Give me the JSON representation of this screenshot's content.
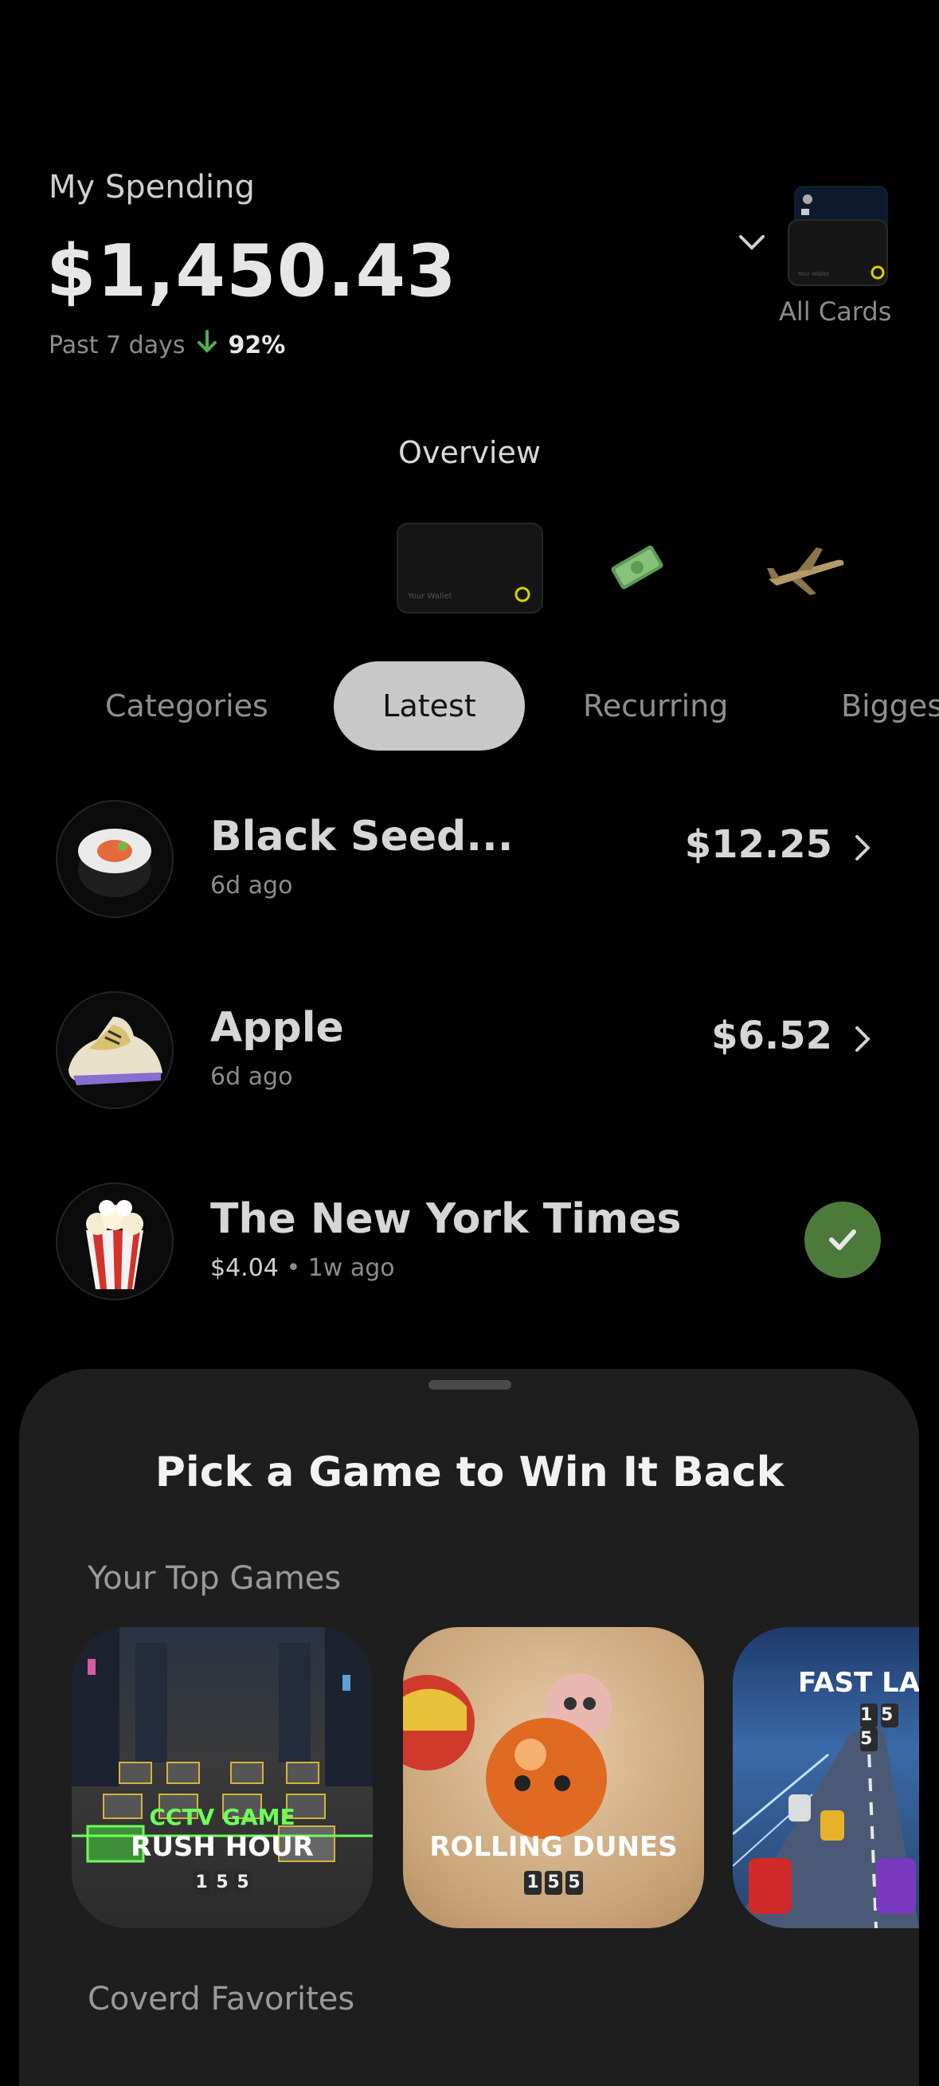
{
  "header": {
    "title": "My Spending",
    "amount": "$1,450.43",
    "period": "Past 7 days",
    "change_pct": "92%",
    "cards_label": "All Cards"
  },
  "overview": {
    "title": "Overview",
    "card_text": "Your Wallet"
  },
  "tabs": [
    {
      "label": "Categories",
      "active": false
    },
    {
      "label": "Latest",
      "active": true
    },
    {
      "label": "Recurring",
      "active": false
    },
    {
      "label": "Biggest",
      "active": false
    }
  ],
  "transactions": [
    {
      "name": "Black Seed...",
      "time": "6d ago",
      "amount": "$12.25",
      "icon": "sushi-icon"
    },
    {
      "name": "Apple",
      "time": "6d ago",
      "amount": "$6.52",
      "icon": "sneaker-icon"
    },
    {
      "name": "The New York Times",
      "amount": "$4.04",
      "time": "• 1w ago",
      "icon": "popcorn-icon",
      "status": "covered"
    }
  ],
  "sheet": {
    "title": "Pick a Game to Win It Back",
    "top_games_label": "Your Top Games",
    "favorites_label": "Coverd Favorites",
    "games": [
      {
        "title_line1": "CCTV GAME",
        "title_line2": "RUSH HOUR",
        "digits": "155"
      },
      {
        "title_line1": "ROLLING DUNES",
        "digits": "155"
      },
      {
        "title_line1": "FAST LA",
        "digits": "155"
      }
    ]
  },
  "colors": {
    "background": "#000000",
    "sheet": "#1e1e1e",
    "active_tab": "#c8c8c8",
    "positive": "#4b7a3a",
    "arrow_down": "#4caf50"
  }
}
